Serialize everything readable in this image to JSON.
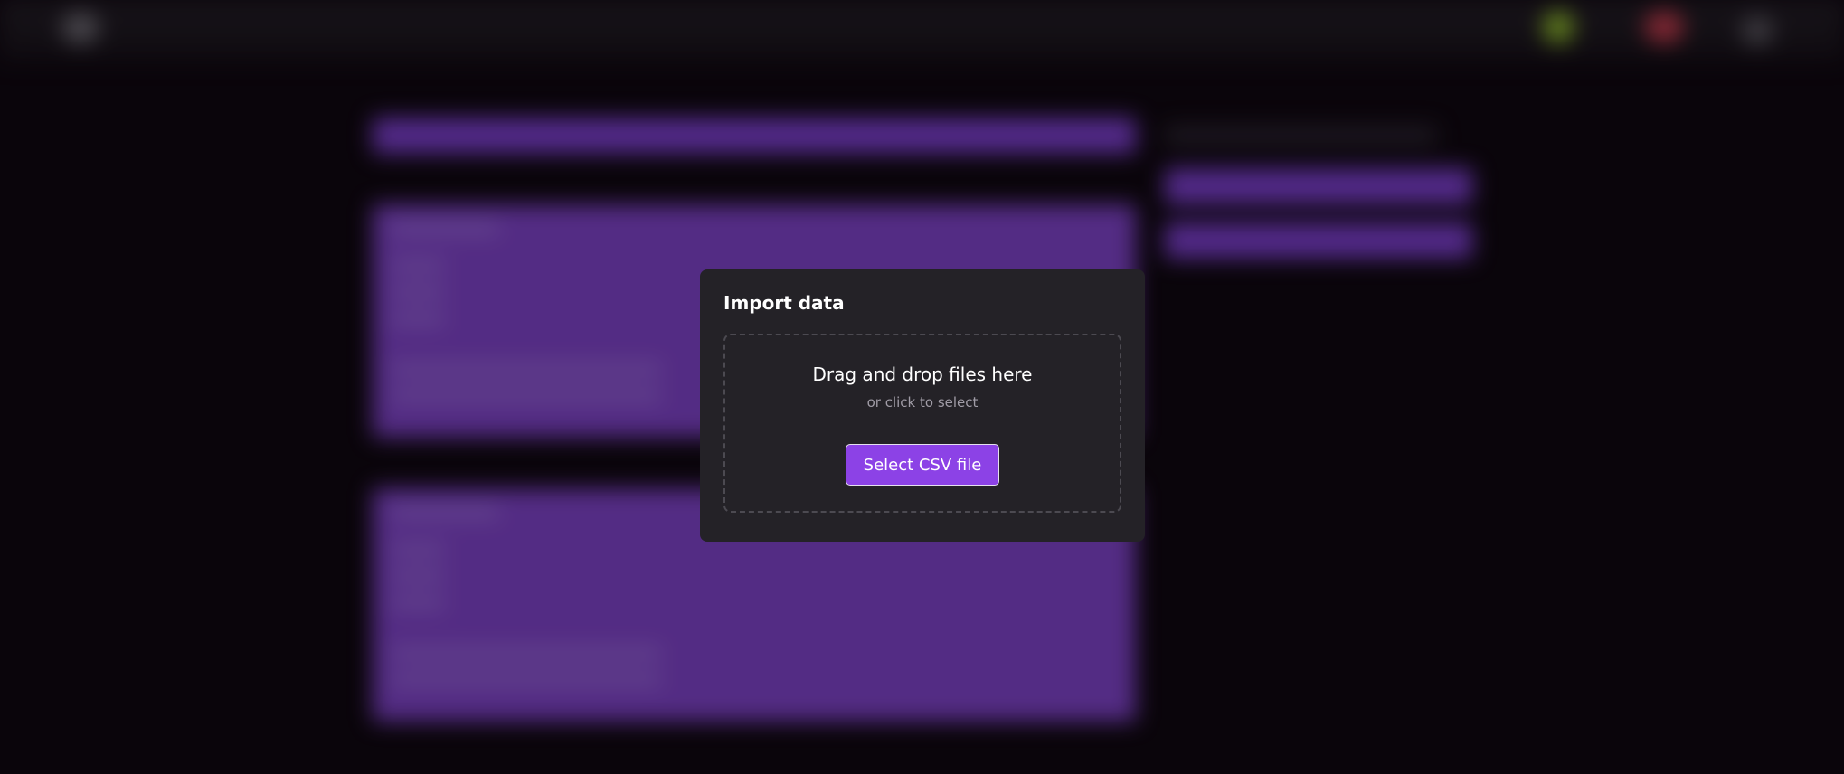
{
  "modal": {
    "title": "Import data",
    "dropzone": {
      "primary_text": "Drag and drop files here",
      "secondary_text": "or click to select"
    },
    "select_button_label": "Select CSV file"
  },
  "colors": {
    "accent": "#8c42e6",
    "modal_background": "#242227",
    "page_background": "#0c070d"
  }
}
